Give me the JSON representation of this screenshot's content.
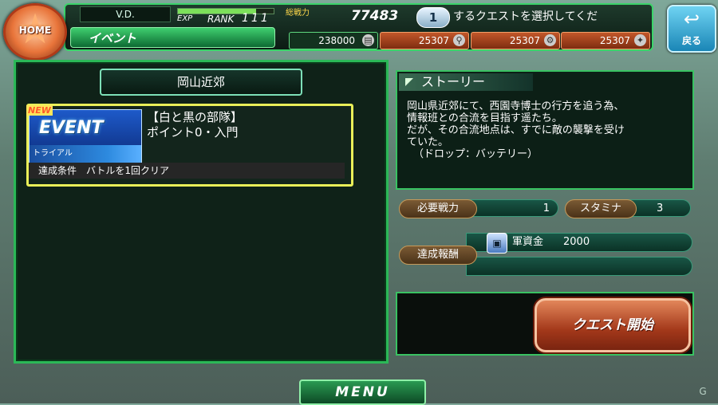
{
  "home": {
    "label": "HOME"
  },
  "back": {
    "label": "戻る"
  },
  "header": {
    "player": "V.D.",
    "exp_label": "EXP",
    "rank_label": "RANK",
    "rank_value": "111",
    "total_power_label": "総戦力",
    "total_power_value": "77483",
    "badge": "1",
    "marquee": "するクエストを選択してくだ",
    "tab": "イベント"
  },
  "resources": {
    "gauge": "238000",
    "r1": "25307",
    "r2": "25307",
    "r3": "25307"
  },
  "location": "岡山近郊",
  "quest": {
    "new_badge": "NEW",
    "event_label": "EVENT",
    "trial_label": "トライアル",
    "title_line1": "【白と黒の部隊】",
    "title_line2": "ポイント0・入門",
    "condition": "達成条件　バトルを1回クリア"
  },
  "story": {
    "header": "ストーリー",
    "line1": "岡山県近郊にて、西園寺博士の行方を追う為、",
    "line2": "情報班との合流を目指す遥たち。",
    "line3": "だが、その合流地点は、すでに敵の襲撃を受け",
    "line4": "ていた。",
    "line5": "（ドロップ：バッテリー）"
  },
  "requirements": {
    "power_label": "必要戦力",
    "power_value": "1",
    "stamina_label": "スタミナ",
    "stamina_value": "3"
  },
  "reward": {
    "label": "達成報酬",
    "item_name": "軍資金",
    "item_value": "2000"
  },
  "buttons": {
    "start": "クエスト開始",
    "menu": "MENU"
  },
  "watermark": "G"
}
